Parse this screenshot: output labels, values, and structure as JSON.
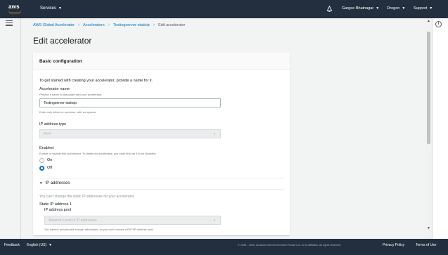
{
  "topbar": {
    "logo_text": "aws",
    "services_label": "Services",
    "user_label": "Gargee Bhatnagar",
    "region_label": "Oregon",
    "support_label": "Support"
  },
  "breadcrumb": {
    "items": [
      "AWS Global Accelerator",
      "Accelerators",
      "Testingserver-staticip"
    ],
    "current": "Edit accelerator"
  },
  "page": {
    "title": "Edit accelerator"
  },
  "panel": {
    "title": "Basic configuration",
    "intro": "To get started with creating your accelerator, provide a name for it.",
    "name_label": "Accelerator name",
    "name_desc": "Provide a name to associate with your accelerator.",
    "name_value": "Testingserver-staticip",
    "name_hint": "Enter only letters or numbers, with no spaces.",
    "ip_type_label": "IP address type",
    "ip_type_value": "IPv4",
    "enabled_label": "Enabled",
    "enabled_desc": "Enable or disable this accelerator. To delete an accelerator, you must first set it to be disabled.",
    "on_label": "On",
    "off_label": "Off",
    "ip_section_label": "IP addresses",
    "ip_static_note": "You can't change the static IP addresses for your accelerator.",
    "static_ip_label": "Static IP address 1",
    "ip_pool_label": "IP address pool",
    "ip_pool_value": "Amazon's pool of IP addresses",
    "ip_pool_hint": "You haven't provisioned enough addresses, so you can't choose a BYOIP address pool."
  },
  "footer": {
    "feedback": "Feedback",
    "language": "English (US)",
    "copyright": "© 2008 - 2020, Amazon Internet Services Private Ltd. or its affiliates. All rights reserved.",
    "privacy": "Privacy Policy",
    "terms": "Terms of Use"
  },
  "icons": {
    "menu": "hamburger-icon",
    "info": "info-icon",
    "bell": "bell-icon"
  },
  "colors": {
    "nav_bg": "#232f3e",
    "link": "#0073bb",
    "accent": "#ff9900"
  }
}
